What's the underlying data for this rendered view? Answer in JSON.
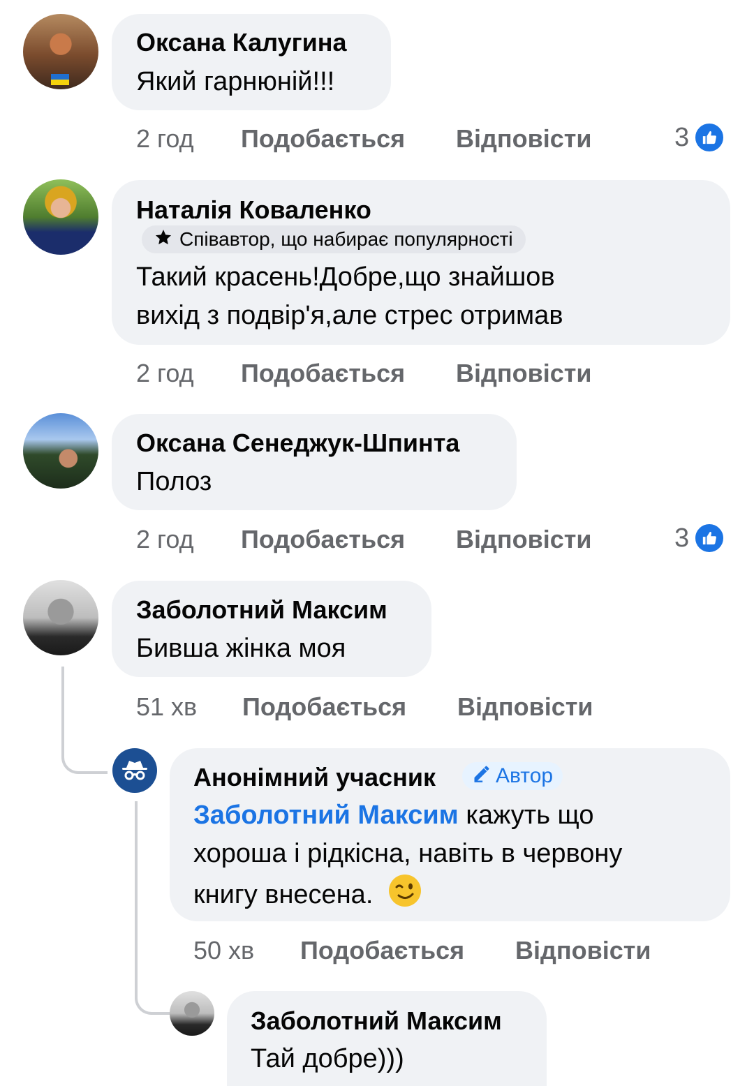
{
  "colors": {
    "link": "#1b74e4",
    "bubble": "#f0f2f5",
    "meta": "#65676b"
  },
  "actions": {
    "like": "Подобається",
    "reply": "Відповісти"
  },
  "comments": [
    {
      "name": "Оксана Калугина",
      "text": "Який гарнюній!!!",
      "time": "2 год",
      "reactions": "3"
    },
    {
      "name": "Наталія Коваленко",
      "badge": "Співавтор, що набирає популярності",
      "text_lines": [
        "Такий красень!Добре,що знайшов",
        "вихід з подвір'я,але стрес отримав"
      ],
      "time": "2 год"
    },
    {
      "name": "Оксана Сенеджук-Шпинта",
      "text": "Полоз",
      "time": "2 год",
      "reactions": "3"
    },
    {
      "name": "Заболотний Максим",
      "text": "Бивша жінка моя",
      "time": "51 хв"
    }
  ],
  "reply1": {
    "name": "Анонімний учасник",
    "author_badge": "Автор",
    "mention": "Заболотний Максим",
    "line1_rest": " кажуть що",
    "line2": "хороша і рідкісна, навіть в червону",
    "line3": "книгу внесена.",
    "emoji": "winking-face",
    "time": "50 хв"
  },
  "reply2": {
    "name": "Заболотний Максим",
    "text": "Тай добре)))"
  }
}
